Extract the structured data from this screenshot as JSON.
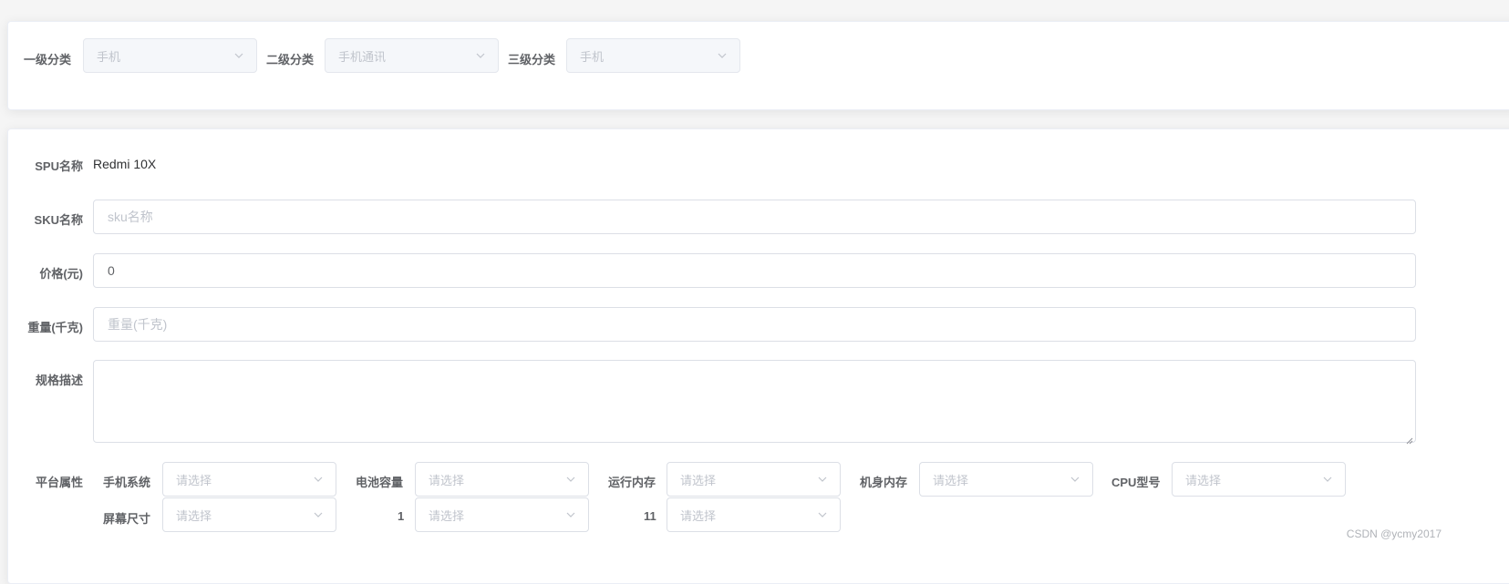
{
  "category": {
    "level1_label": "一级分类",
    "level1_value": "手机",
    "level2_label": "二级分类",
    "level2_value": "手机通讯",
    "level3_label": "三级分类",
    "level3_value": "手机"
  },
  "form": {
    "spu_label": "SPU名称",
    "spu_value": "Redmi 10X",
    "sku_label": "SKU名称",
    "sku_placeholder": "sku名称",
    "price_label": "价格(元)",
    "price_value": "0",
    "weight_label": "重量(千克)",
    "weight_placeholder": "重量(千克)",
    "desc_label": "规格描述",
    "platform_label": "平台属性"
  },
  "attrs": [
    {
      "label": "手机系统",
      "placeholder": "请选择"
    },
    {
      "label": "电池容量",
      "placeholder": "请选择"
    },
    {
      "label": "运行内存",
      "placeholder": "请选择"
    },
    {
      "label": "机身内存",
      "placeholder": "请选择"
    },
    {
      "label": "CPU型号",
      "placeholder": "请选择"
    },
    {
      "label": "屏幕尺寸",
      "placeholder": "请选择"
    },
    {
      "label": "1",
      "placeholder": "请选择"
    },
    {
      "label": "11",
      "placeholder": "请选择"
    }
  ],
  "watermark": "CSDN @ycmy2017",
  "icons": {
    "select_arrow": "chevron-down-icon"
  }
}
